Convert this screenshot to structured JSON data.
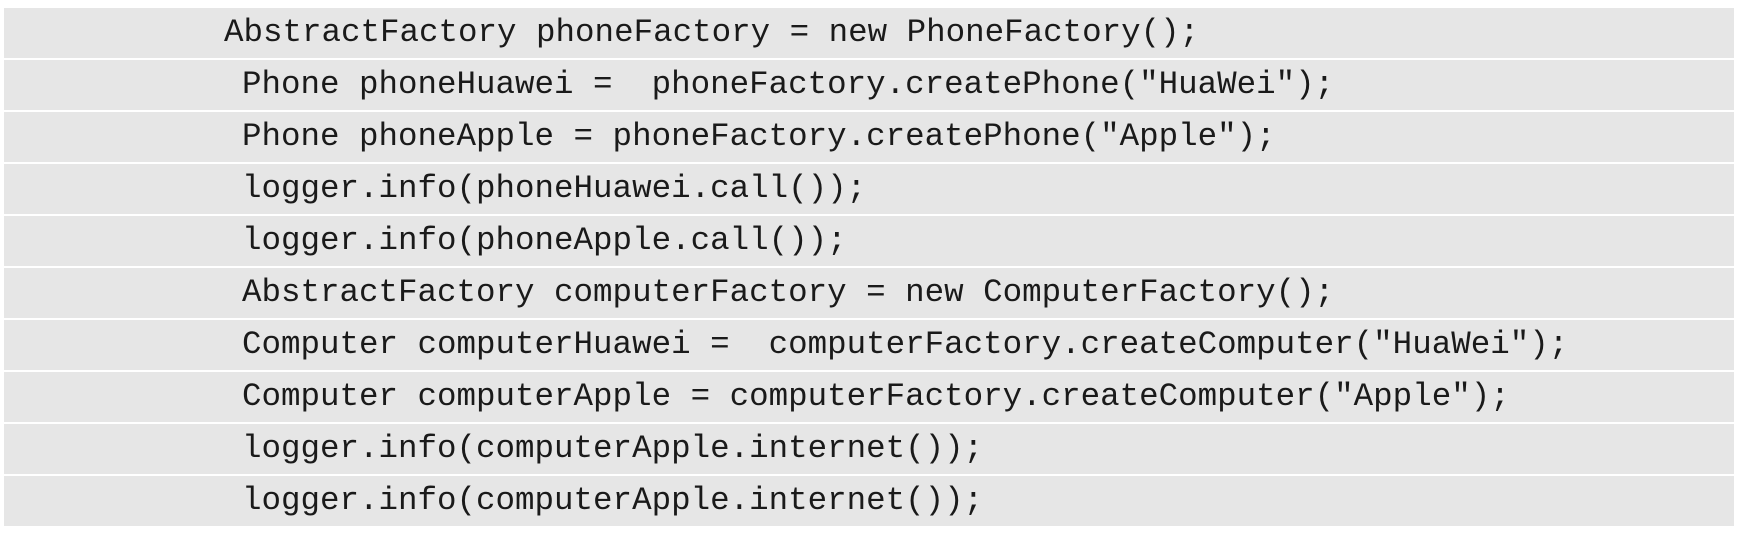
{
  "code": {
    "lines": [
      "AbstractFactory phoneFactory = new PhoneFactory();",
      "Phone phoneHuawei =  phoneFactory.createPhone(\"HuaWei\");",
      "Phone phoneApple = phoneFactory.createPhone(\"Apple\");",
      "logger.info(phoneHuawei.call());",
      "logger.info(phoneApple.call());",
      "AbstractFactory computerFactory = new ComputerFactory();",
      "Computer computerHuawei =  computerFactory.createComputer(\"HuaWei\");",
      "Computer computerApple = computerFactory.createComputer(\"Apple\");",
      "logger.info(computerApple.internet());",
      "logger.info(computerApple.internet());"
    ]
  }
}
